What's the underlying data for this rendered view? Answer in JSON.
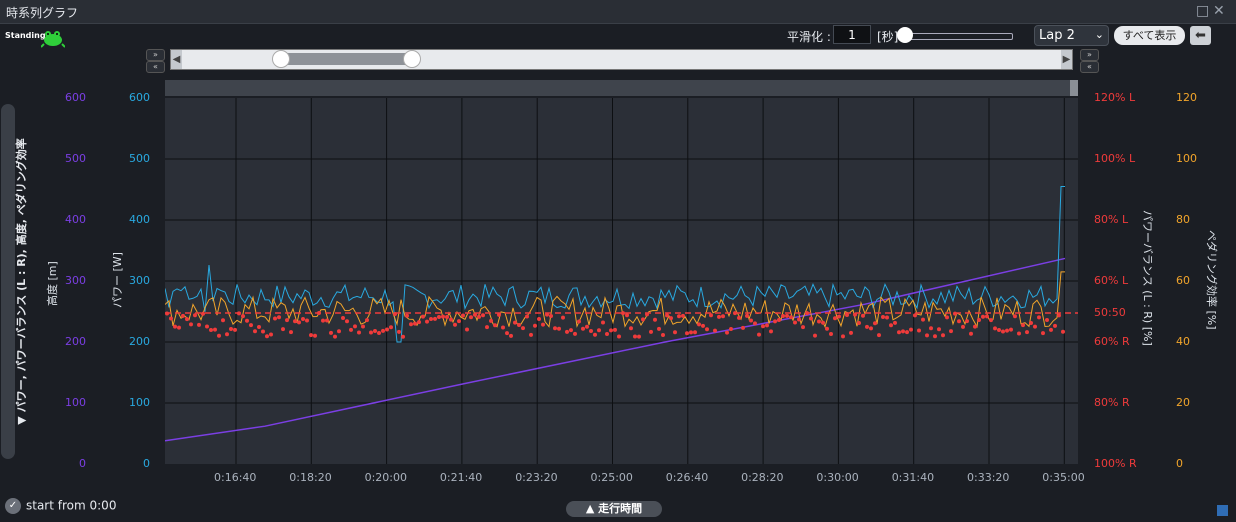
{
  "window": {
    "title": "時系列グラフ",
    "restore_icon": "□",
    "close_icon": "✕"
  },
  "badge": {
    "label": "Standing",
    "icon": "frog-icon",
    "color": "#2fcf3a"
  },
  "controls": {
    "smoothing_label": "平滑化 :",
    "smoothing_value": "1",
    "smoothing_unit": "[秒]",
    "smoothing_level": 0,
    "lap_select": "Lap 2",
    "show_all": "すべて表示",
    "back_icon": "back-arrow-icon"
  },
  "range": {
    "expand_label": "»",
    "collapse_label": "«",
    "start_fraction": 0.12,
    "end_fraction": 0.27
  },
  "side_tab": "▼ パワー, パワーバランス (L : R), 高度, ペダリング効率",
  "axes": {
    "altitude": {
      "label": "高度 [m]",
      "color": "#7b3fe4",
      "ticks": [
        "600",
        "500",
        "400",
        "300",
        "200",
        "100",
        "0"
      ]
    },
    "power": {
      "label": "パワー [W]",
      "color": "#29a9e0",
      "ticks": [
        "600",
        "500",
        "400",
        "300",
        "200",
        "100",
        "0"
      ]
    },
    "balance": {
      "label": "パワーバランス (L : R) [%]",
      "color": "#ef3b3b",
      "ticks": [
        "120% L",
        "100% L",
        "80% L",
        "60% L",
        "50:50",
        "60% R",
        "80% R",
        "100% R"
      ]
    },
    "efficiency": {
      "label": "ペダリング効率 [%]",
      "color": "#f2a52b",
      "ticks": [
        "120",
        "100",
        "80",
        "60",
        "40",
        "20",
        "0"
      ]
    },
    "x_ticks": [
      "0:16:40",
      "0:18:20",
      "0:20:00",
      "0:21:40",
      "0:23:20",
      "0:25:00",
      "0:26:40",
      "0:28:20",
      "0:30:00",
      "0:31:40",
      "0:33:20",
      "0:35:00"
    ]
  },
  "footer": {
    "start_from": "start from 0:00",
    "x_axis_button": "▲ 走行時間"
  },
  "chart_data": {
    "type": "line",
    "x_range": [
      "0:15:20",
      "0:35:20"
    ],
    "series": [
      {
        "name": "高度",
        "unit": "m",
        "shape": "rising line",
        "start": 38,
        "end": 337
      },
      {
        "name": "パワー",
        "unit": "W",
        "typical": 275,
        "min": 200,
        "max": 455
      },
      {
        "name": "ペダリング効率",
        "unit": "%",
        "typical": 50,
        "min": 38,
        "max": 63
      },
      {
        "name": "パワーバランス",
        "unit": "%",
        "typical": "50:50 to 55% R",
        "style": "dots"
      }
    ],
    "reference_line": "50:50"
  }
}
